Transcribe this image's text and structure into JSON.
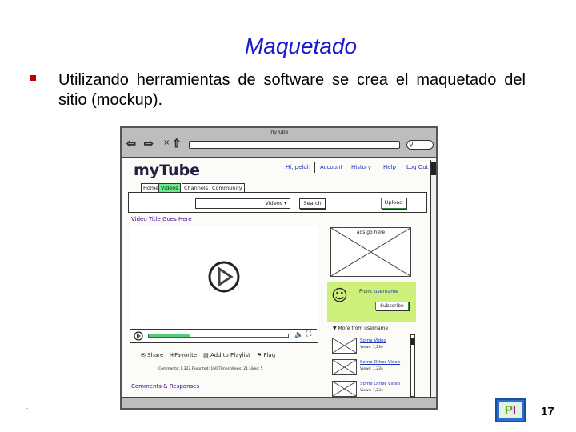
{
  "slide": {
    "title": "Maquetado",
    "bullet_text": "Utilizando herramientas de software se crea el maquetado del sitio (mockup).",
    "page_number": "17",
    "footer_left": "- ."
  },
  "mockup": {
    "window_title": "myTube",
    "logo": "myTube",
    "links": [
      "Hi, peldi!",
      "Account",
      "History",
      "Help",
      "Log Out"
    ],
    "tabs": [
      "Home",
      "Videos",
      "Channels",
      "Community"
    ],
    "search_scope": "Videos",
    "search_button": "Search",
    "upload_button": "Upload",
    "video_title": "Video Title Goes Here",
    "progress": 0.3,
    "actions": [
      "Share",
      "Favorite",
      "Add to Playlist",
      "Flag"
    ],
    "stats": "Comments: 1,322  Favorited: 160  Times  Views: 21  Likes: 5",
    "comments_heading": "Comments & Responses",
    "ads": "ads go here",
    "from_label": "From:",
    "username": "username",
    "subscribe_button": "Subscribe",
    "more_from": "More from username",
    "related": [
      {
        "title": "Some Video",
        "views": "Views: 1,234"
      },
      {
        "title": "Some Other Video",
        "views": "Views: 1,234"
      },
      {
        "title": "Some Other Video",
        "views": "Views: 1,234"
      }
    ]
  },
  "colors": {
    "title": "#1a1acc",
    "bullet": "#c00000",
    "tab_active": "#66ee88",
    "user_panel": "#ccf07a",
    "progress": "#55cc77",
    "link": "#2233bb",
    "heading": "#440099"
  }
}
